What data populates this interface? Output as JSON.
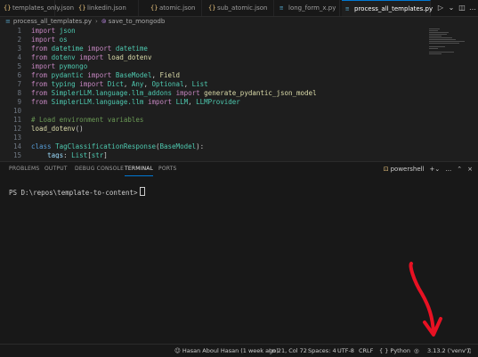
{
  "tabs": [
    {
      "label": "templates_only.json",
      "type": "json"
    },
    {
      "label": "linkedin.json",
      "type": "json"
    },
    {
      "label": "atomic.json",
      "type": "json"
    },
    {
      "label": "sub_atomic.json",
      "type": "json"
    },
    {
      "label": "long_form_x.py",
      "type": "py"
    },
    {
      "label": "process_all_templates.py",
      "type": "py",
      "active": true
    }
  ],
  "tab_actions": [
    "run-icon",
    "chevron-down-icon",
    "split-editor-icon",
    "more-icon"
  ],
  "breadcrumb": {
    "file": "process_all_templates.py",
    "symbol": "save_to_mongodb"
  },
  "code_lines": [
    "1",
    "2",
    "3",
    "4",
    "5",
    "6",
    "7",
    "8",
    "9",
    "10",
    "11",
    "12",
    "13",
    "14",
    "15"
  ],
  "panel": {
    "tabs": [
      "PROBLEMS",
      "OUTPUT",
      "DEBUG CONSOLE",
      "TERMINAL",
      "PORTS"
    ],
    "active_tab": "TERMINAL",
    "shell": "powershell",
    "prompt": "PS D:\\repos\\template-to-content>"
  },
  "status": {
    "git_blame": "Hasan Aboul Hasan (1 week ago)",
    "position": "Ln 21, Col 72",
    "spaces": "Spaces: 4",
    "encoding": "UTF-8",
    "eol": "CRLF",
    "language": "{ }  Python",
    "interpreter": "3.13.2 ('venv')"
  },
  "colors": {
    "accent": "#0078d4",
    "annotation_arrow": "#e81123"
  }
}
